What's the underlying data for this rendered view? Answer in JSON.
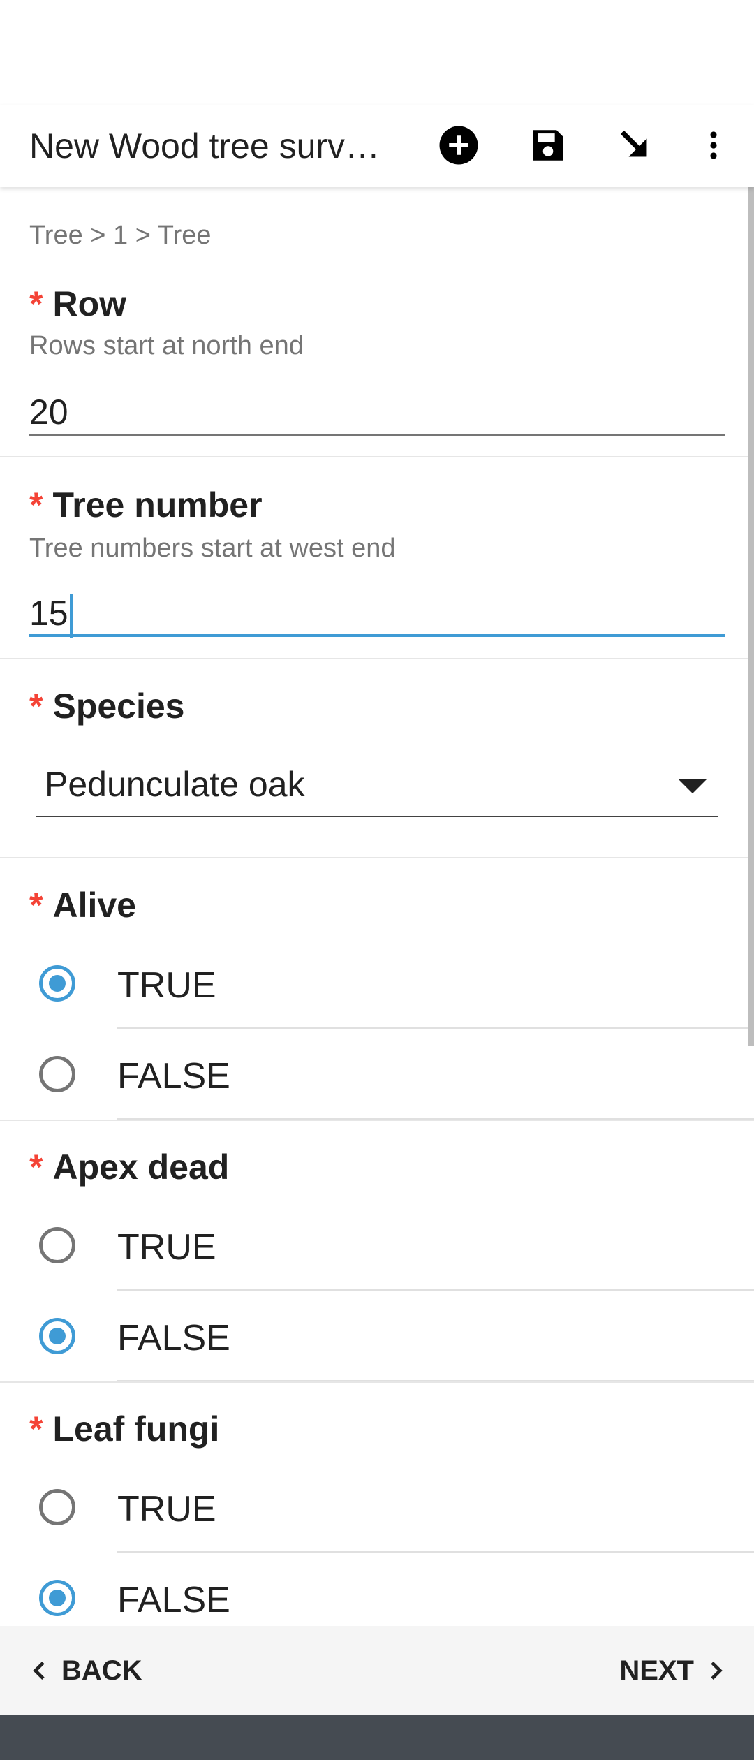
{
  "app_bar": {
    "title": "New Wood tree surv…",
    "icons": [
      "add-circle-icon",
      "save-icon",
      "arrow-down-right-icon",
      "more-vertical-icon"
    ]
  },
  "breadcrumb": "Tree > 1 > Tree",
  "required_marker": "*",
  "questions": {
    "row": {
      "label": "Row",
      "hint": "Rows start at north end",
      "value": "20"
    },
    "tree_number": {
      "label": "Tree number",
      "hint": "Tree numbers start at west end",
      "value": "15"
    },
    "species": {
      "label": "Species",
      "value": "Pedunculate oak"
    },
    "alive": {
      "label": "Alive",
      "options": [
        "TRUE",
        "FALSE"
      ],
      "selected": "TRUE"
    },
    "apex_dead": {
      "label": "Apex dead",
      "options": [
        "TRUE",
        "FALSE"
      ],
      "selected": "FALSE"
    },
    "leaf_fungi": {
      "label": "Leaf fungi",
      "options": [
        "TRUE",
        "FALSE"
      ],
      "selected": "FALSE"
    }
  },
  "nav": {
    "back": "BACK",
    "next": "NEXT"
  },
  "colors": {
    "accent": "#3f9bd5",
    "required": "#f44336",
    "system_bar": "#454b52"
  }
}
